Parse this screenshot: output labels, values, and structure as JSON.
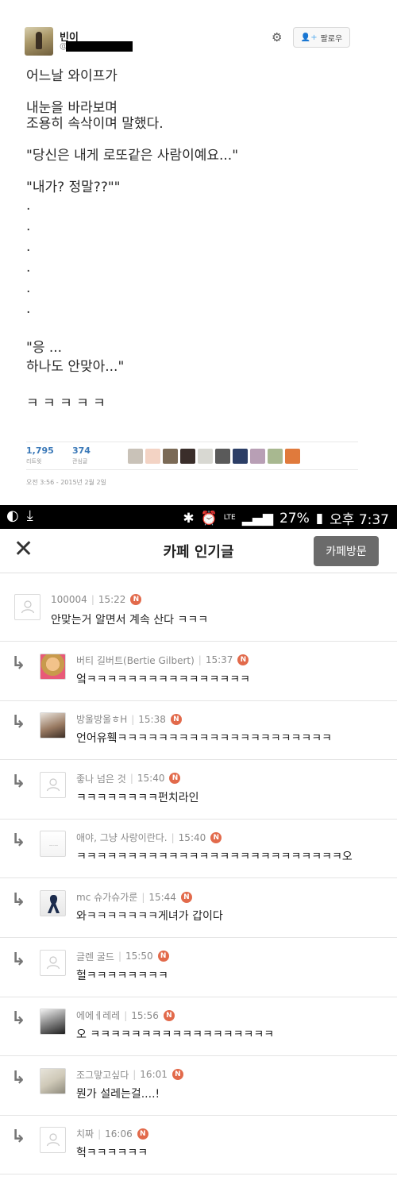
{
  "tweet": {
    "name": "빈이",
    "handle": "@",
    "follow_label": "팔로우",
    "lines": [
      "어느날 와이프가",
      "",
      "내눈을 바라보며",
      "조용히 속삭이며 말했다.",
      "",
      "\"당신은 내게 로또같은 사람이예요...\"",
      "",
      "\"내가? 정말??\"\"",
      ".",
      ".",
      ".",
      ".",
      ".",
      ".",
      "",
      "\"응 ...",
      "하나도 안맞아...\"",
      "",
      "ㅋ ㅋ ㅋ ㅋ ㅋ"
    ],
    "retweets": "1,795",
    "retweets_label": "리트윗",
    "likes": "374",
    "likes_label": "관심글",
    "timestamp": "오전 3:56 - 2015년 2월 2일"
  },
  "status_bar": {
    "battery": "27%",
    "network": "LTE",
    "time": "오후 7:37"
  },
  "header": {
    "title": "카페 인기글",
    "visit_button": "카페방문"
  },
  "comments": [
    {
      "author": "100004",
      "time": "15:22",
      "text": "안맞는거 알면서 계속 산다 ㅋㅋㅋ",
      "reply": false,
      "avatar": "default"
    },
    {
      "author": "버티 길버트(Bertie Gilbert)",
      "time": "15:37",
      "text": "엌ㅋㅋㅋㅋㅋㅋㅋㅋㅋㅋㅋㅋㅋㅋㅋㅋ",
      "reply": true,
      "avatar": "photo1"
    },
    {
      "author": "방울방울ㅎH",
      "time": "15:38",
      "text": "언어유훽ㅋㅋㅋㅋㅋㅋㅋㅋㅋㅋㅋㅋㅋㅋㅋㅋㅋㅋㅋㅋㅋ",
      "reply": true,
      "avatar": "photo2"
    },
    {
      "author": "좋나 넘은 것",
      "time": "15:40",
      "text": "ㅋㅋㅋㅋㅋㅋㅋㅋ펀치라인",
      "reply": true,
      "avatar": "default"
    },
    {
      "author": "애야, 그냥 사랑이란다.",
      "time": "15:40",
      "text": "ㅋㅋㅋㅋㅋㅋㅋㅋㅋㅋㅋㅋㅋㅋㅋㅋㅋㅋㅋㅋㅋㅋㅋㅋㅋㅋ오",
      "reply": true,
      "avatar": "photo3"
    },
    {
      "author": "mc 슈가슈가룬",
      "time": "15:44",
      "text": "와ㅋㅋㅋㅋㅋㅋㅋ게녀가 갑이다",
      "reply": true,
      "avatar": "photo4"
    },
    {
      "author": "글렌 굴드",
      "time": "15:50",
      "text": "헐ㅋㅋㅋㅋㅋㅋㅋㅋ",
      "reply": true,
      "avatar": "default"
    },
    {
      "author": "에에ㅔ레레",
      "time": "15:56",
      "text": "오 ㅋㅋㅋㅋㅋㅋㅋㅋㅋㅋㅋㅋㅋㅋㅋㅋㅋㅋ",
      "reply": true,
      "avatar": "photo5"
    },
    {
      "author": "조그맣고싶다",
      "time": "16:01",
      "text": "뭔가 설레는걸....!",
      "reply": true,
      "avatar": "photo6"
    },
    {
      "author": "치짜",
      "time": "16:06",
      "text": "헉ㅋㅋㅋㅋㅋㅋ",
      "reply": true,
      "avatar": "default"
    }
  ],
  "colors": {
    "accent_badge": "#e26a4b",
    "link_blue": "#3b79b8",
    "header_button": "#6b6b6b"
  }
}
